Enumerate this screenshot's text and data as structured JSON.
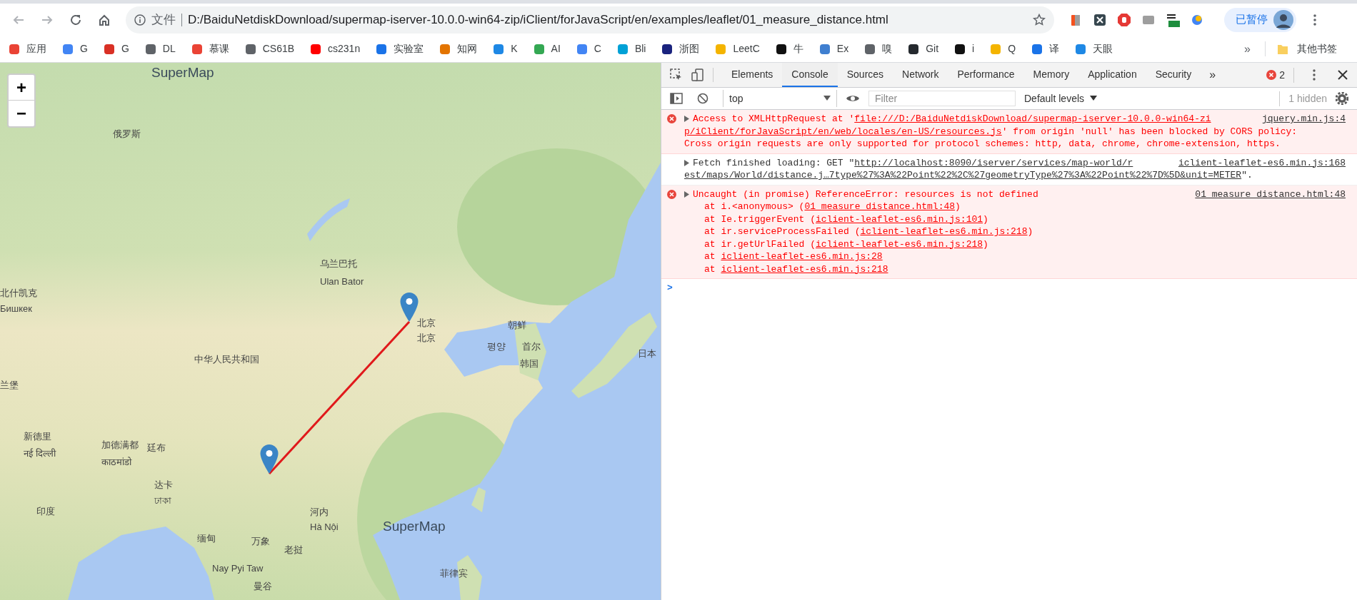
{
  "browser": {
    "address_bar": {
      "security_label": "文件",
      "url": "D:/BaiduNetdiskDownload/supermap-iserver-10.0.0-win64-zip/iClient/forJavaScript/en/examples/leaflet/01_measure_distance.html"
    },
    "profile": {
      "label": "已暂停"
    },
    "bookmarks": [
      {
        "label": "应用"
      },
      {
        "label": "G"
      },
      {
        "label": "G"
      },
      {
        "label": "DL"
      },
      {
        "label": "慕课"
      },
      {
        "label": "CS61B"
      },
      {
        "label": "cs231n"
      },
      {
        "label": "实验室"
      },
      {
        "label": "知网"
      },
      {
        "label": "K"
      },
      {
        "label": "AI"
      },
      {
        "label": "C"
      },
      {
        "label": "Bli"
      },
      {
        "label": "浙图"
      },
      {
        "label": "LeetC"
      },
      {
        "label": "牛"
      },
      {
        "label": "Ex"
      },
      {
        "label": "嗅"
      },
      {
        "label": "Git"
      },
      {
        "label": "i"
      },
      {
        "label": "Q"
      },
      {
        "label": "译"
      },
      {
        "label": "天眼"
      }
    ],
    "bookmarks_overflow": "»",
    "other_bookmarks": "其他书签"
  },
  "map": {
    "zoom_in": "+",
    "zoom_out": "−",
    "labels": [
      {
        "text": "SuperMap",
        "kind": "logo"
      },
      {
        "text": "俄罗斯",
        "kind": "place"
      },
      {
        "text": "乌兰巴托",
        "kind": "place"
      },
      {
        "text": "Ulan Bator",
        "kind": "place"
      },
      {
        "text": "北什凯克",
        "kind": "place"
      },
      {
        "text": "Бишкек",
        "kind": "place"
      },
      {
        "text": "北京",
        "kind": "place"
      },
      {
        "text": "北京",
        "kind": "place"
      },
      {
        "text": "朝鲜",
        "kind": "place"
      },
      {
        "text": "평양",
        "kind": "place"
      },
      {
        "text": "首尔",
        "kind": "place"
      },
      {
        "text": "韩国",
        "kind": "place"
      },
      {
        "text": "日本",
        "kind": "place"
      },
      {
        "text": "中华人民共和国",
        "kind": "place"
      },
      {
        "text": "兰堡",
        "kind": "place"
      },
      {
        "text": "新德里",
        "kind": "place"
      },
      {
        "text": "नई दिल्ली",
        "kind": "place"
      },
      {
        "text": "加德满都",
        "kind": "place"
      },
      {
        "text": "काठमांडो",
        "kind": "place"
      },
      {
        "text": "廷布",
        "kind": "place"
      },
      {
        "text": "达卡",
        "kind": "place"
      },
      {
        "text": "ঢাকা",
        "kind": "place"
      },
      {
        "text": "印度",
        "kind": "place"
      },
      {
        "text": "河内",
        "kind": "place"
      },
      {
        "text": "Hà Nội",
        "kind": "place"
      },
      {
        "text": "SuperMap",
        "kind": "logo"
      },
      {
        "text": "缅甸",
        "kind": "place"
      },
      {
        "text": "万象",
        "kind": "place"
      },
      {
        "text": "老挝",
        "kind": "place"
      },
      {
        "text": "Nay Pyi Taw",
        "kind": "place"
      },
      {
        "text": "曼谷",
        "kind": "place"
      },
      {
        "text": "菲律宾",
        "kind": "place"
      }
    ]
  },
  "devtools": {
    "tabs": [
      {
        "label": "Elements",
        "selected": false
      },
      {
        "label": "Console",
        "selected": true
      },
      {
        "label": "Sources",
        "selected": false
      },
      {
        "label": "Network",
        "selected": false
      },
      {
        "label": "Performance",
        "selected": false
      },
      {
        "label": "Memory",
        "selected": false
      },
      {
        "label": "Application",
        "selected": false
      },
      {
        "label": "Security",
        "selected": false
      }
    ],
    "more_tabs": "»",
    "error_count": "2",
    "context": "top",
    "filter": {
      "placeholder": "Filter"
    },
    "levels": "Default levels",
    "hidden": "1 hidden",
    "messages": [
      {
        "kind": "error",
        "source": "jquery.min.js:4",
        "lines": [
          [
            {
              "text": "Access to XMLHttpRequest at '",
              "link": false
            },
            {
              "text": "file:///D:/BaiduNetdiskDownload/supermap-iserver-10.0.0-win64-zi",
              "link": true
            }
          ],
          [
            {
              "text": "p/iClient/forJavaScript/en/web/locales/en-US/resources.js",
              "link": true
            },
            {
              "text": "' from origin 'null' has been blocked by CORS policy:",
              "link": false
            }
          ],
          [
            {
              "text": "Cross origin requests are only supported for protocol schemes: http, data, chrome, chrome-extension, https.",
              "link": false
            }
          ]
        ]
      },
      {
        "kind": "info",
        "source": "iclient-leaflet-es6.min.js:168",
        "lines": [
          [
            {
              "text": "Fetch finished loading: GET \"",
              "link": false
            },
            {
              "text": "http://localhost:8090/iserver/services/map-world/r",
              "link": true
            }
          ],
          [
            {
              "text": "est/maps/World/distance.j…7type%27%3A%22Point%22%2C%27geometryType%27%3A%22Point%22%7D%5D&unit=METER",
              "link": true
            },
            {
              "text": "\".",
              "link": false
            }
          ]
        ]
      },
      {
        "kind": "error",
        "source": "01_measure_distance.html:48",
        "lines": [
          [
            {
              "text": "Uncaught (in promise) ReferenceError: resources is not defined",
              "link": false
            }
          ]
        ],
        "stack": [
          [
            {
              "text": "at i.<anonymous> (",
              "link": false
            },
            {
              "text": "01_measure_distance.html:48",
              "link": true
            },
            {
              "text": ")",
              "link": false
            }
          ],
          [
            {
              "text": "at Ie.triggerEvent (",
              "link": false
            },
            {
              "text": "iclient-leaflet-es6.min.js:101",
              "link": true
            },
            {
              "text": ")",
              "link": false
            }
          ],
          [
            {
              "text": "at ir.serviceProcessFailed (",
              "link": false
            },
            {
              "text": "iclient-leaflet-es6.min.js:218",
              "link": true
            },
            {
              "text": ")",
              "link": false
            }
          ],
          [
            {
              "text": "at ir.getUrlFailed (",
              "link": false
            },
            {
              "text": "iclient-leaflet-es6.min.js:218",
              "link": true
            },
            {
              "text": ")",
              "link": false
            }
          ],
          [
            {
              "text": "at ",
              "link": false
            },
            {
              "text": "iclient-leaflet-es6.min.js:28",
              "link": true
            }
          ],
          [
            {
              "text": "at ",
              "link": false
            },
            {
              "text": "iclient-leaflet-es6.min.js:218",
              "link": true
            }
          ]
        ]
      }
    ],
    "prompt": ">"
  }
}
